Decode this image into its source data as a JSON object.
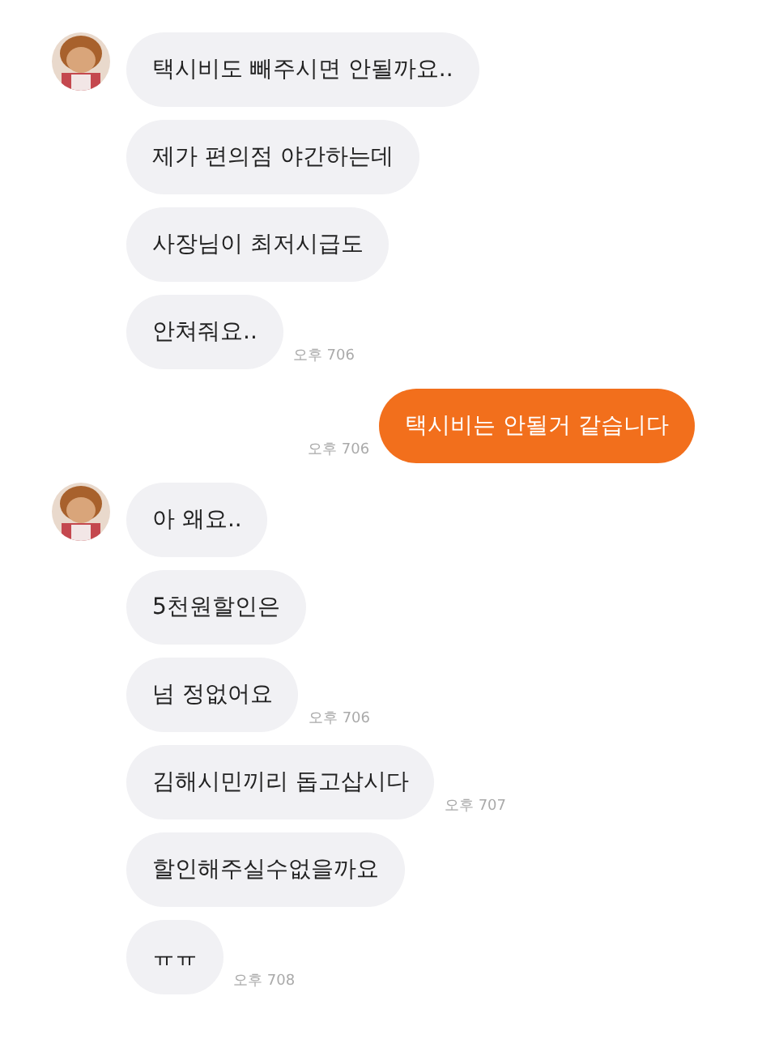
{
  "groups": [
    {
      "kind": "received",
      "messages": [
        {
          "text": "택시비도 빼주시면 안될까요.."
        },
        {
          "text": "제가 편의점 야간하는데"
        },
        {
          "text": "사장님이 최저시급도"
        },
        {
          "text": "안쳐줘요..",
          "time": "오후 706"
        }
      ]
    },
    {
      "kind": "sent",
      "messages": [
        {
          "text": "택시비는 안될거 같습니다",
          "time": "오후 706"
        }
      ]
    },
    {
      "kind": "received",
      "messages": [
        {
          "text": "아 왜요.."
        },
        {
          "text": "5천원할인은"
        },
        {
          "text": "넘 정없어요",
          "time": "오후 706"
        },
        {
          "text": "김해시민끼리 돕고삽시다",
          "time": "오후 707"
        },
        {
          "text": "할인해주실수없을까요"
        },
        {
          "text": "ㅠㅠ",
          "time": "오후 708"
        }
      ]
    }
  ]
}
